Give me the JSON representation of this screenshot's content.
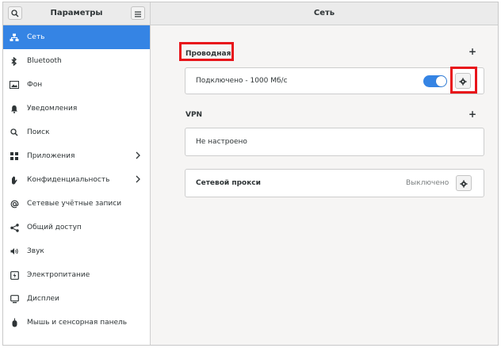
{
  "header": {
    "sidebar_title": "Параметры",
    "page_title": "Сеть",
    "search_icon": "search-icon",
    "menu_icon": "hamburger-menu-icon"
  },
  "sidebar": {
    "items": [
      {
        "label": "Сеть",
        "icon": "network-icon",
        "active": true
      },
      {
        "label": "Bluetooth",
        "icon": "bluetooth-icon"
      },
      {
        "label": "Фон",
        "icon": "background-icon"
      },
      {
        "label": "Уведомления",
        "icon": "bell-icon"
      },
      {
        "label": "Поиск",
        "icon": "search-icon"
      },
      {
        "label": "Приложения",
        "icon": "apps-grid-icon",
        "chevron": true
      },
      {
        "label": "Конфиденциальность",
        "icon": "hand-icon",
        "chevron": true
      },
      {
        "label": "Сетевые учётные записи",
        "icon": "at-icon"
      },
      {
        "label": "Общий доступ",
        "icon": "share-icon"
      },
      {
        "label": "Звук",
        "icon": "speaker-icon"
      },
      {
        "label": "Электропитание",
        "icon": "power-icon"
      },
      {
        "label": "Дисплеи",
        "icon": "display-icon"
      },
      {
        "label": "Мышь и сенсорная панель",
        "icon": "mouse-icon"
      }
    ]
  },
  "wired": {
    "title": "Проводная",
    "add_label": "+",
    "status": "Подключено - 1000 Мб/с",
    "toggle_on": true
  },
  "vpn": {
    "title": "VPN",
    "add_label": "+",
    "status": "Не настроено"
  },
  "proxy": {
    "title": "Сетевой прокси",
    "status": "Выключено"
  },
  "colors": {
    "accent": "#3584e4",
    "highlight": "#e8141a"
  }
}
